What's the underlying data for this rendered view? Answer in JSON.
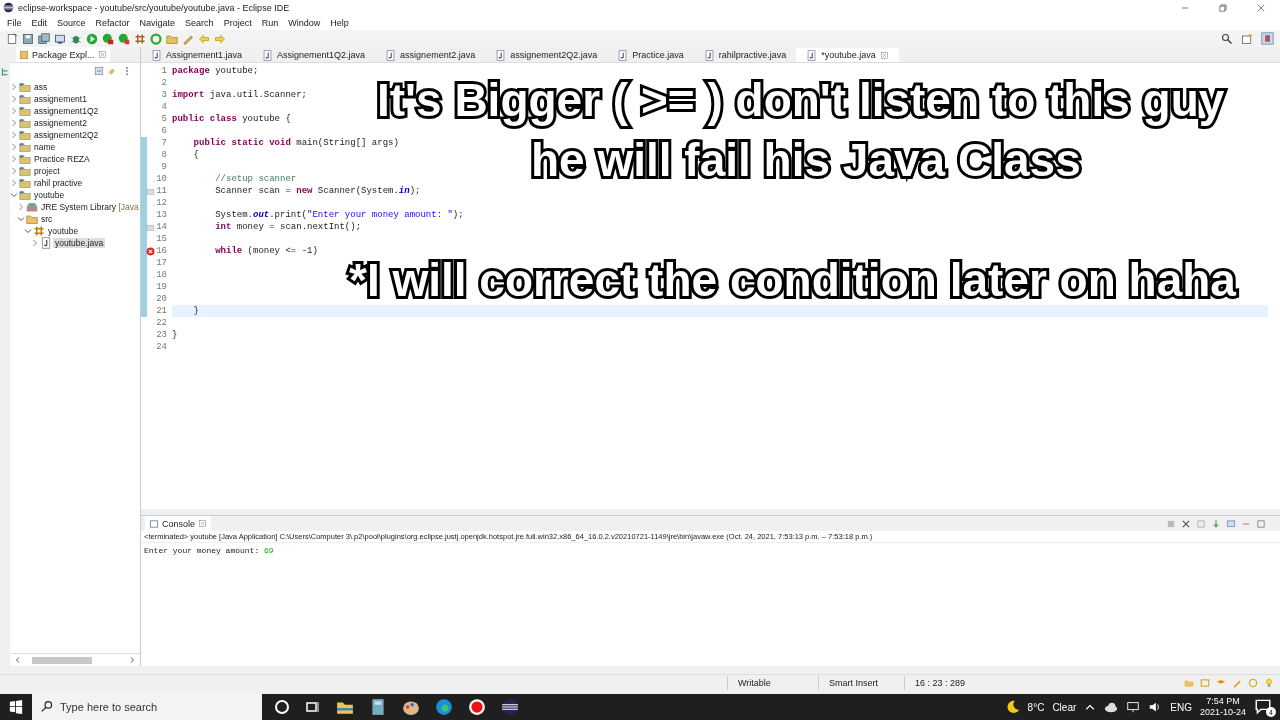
{
  "window": {
    "title": "eclipse-workspace - youtube/src/youtube/youtube.java - Eclipse IDE"
  },
  "menu": [
    "File",
    "Edit",
    "Source",
    "Refactor",
    "Navigate",
    "Search",
    "Project",
    "Run",
    "Window",
    "Help"
  ],
  "package_explorer": {
    "title": "Package Expl...",
    "tree": [
      {
        "label": "ass",
        "kind": "project",
        "expanded": false,
        "selected": false
      },
      {
        "label": "assignement1",
        "kind": "project",
        "expanded": false,
        "selected": false
      },
      {
        "label": "assignement1Q2",
        "kind": "project",
        "expanded": false,
        "selected": false
      },
      {
        "label": "assignement2",
        "kind": "project",
        "expanded": false,
        "selected": false
      },
      {
        "label": "assignement2Q2",
        "kind": "project",
        "expanded": false,
        "selected": false
      },
      {
        "label": "name",
        "kind": "project",
        "expanded": false,
        "selected": false
      },
      {
        "label": "Practice REZA",
        "kind": "project",
        "expanded": false,
        "selected": false
      },
      {
        "label": "project",
        "kind": "project",
        "expanded": false,
        "selected": false
      },
      {
        "label": "rahil practive",
        "kind": "project",
        "expanded": false,
        "selected": false
      },
      {
        "label": "youtube",
        "kind": "project",
        "expanded": true,
        "selected": false,
        "children": [
          {
            "label": "JRE System Library",
            "suffix": "[Java",
            "kind": "library",
            "expanded": false,
            "selected": false
          },
          {
            "label": "src",
            "kind": "folder",
            "expanded": true,
            "selected": false,
            "children": [
              {
                "label": "youtube",
                "kind": "package",
                "expanded": true,
                "selected": false,
                "children": [
                  {
                    "label": "youtube.java",
                    "kind": "file",
                    "expanded": false,
                    "selected": true
                  }
                ]
              }
            ]
          }
        ]
      }
    ]
  },
  "editor": {
    "tabs": [
      {
        "label": "Assignement1.java",
        "selected": false
      },
      {
        "label": "Assignement1Q2.java",
        "selected": false
      },
      {
        "label": "assignement2.java",
        "selected": false
      },
      {
        "label": "assignement2Q2.java",
        "selected": false
      },
      {
        "label": "Practice.java",
        "selected": false
      },
      {
        "label": "rahilpractive.java",
        "selected": false
      },
      {
        "label": "*youtube.java",
        "selected": true
      }
    ],
    "lines": [
      {
        "number": "1",
        "kind": "plain",
        "changed": false,
        "current": false,
        "tokens": [
          {
            "kind": "keyword",
            "text": "package"
          },
          {
            "kind": "plain",
            "text": " youtube;"
          }
        ]
      },
      {
        "number": "2",
        "kind": "plain",
        "changed": false,
        "current": false
      },
      {
        "number": "3",
        "kind": "plain",
        "changed": false,
        "current": false,
        "tokens": [
          {
            "kind": "keyword",
            "text": "import"
          },
          {
            "kind": "plain",
            "text": " java.util.Scanner;"
          }
        ]
      },
      {
        "number": "4",
        "kind": "plain",
        "changed": false,
        "current": false
      },
      {
        "number": "5",
        "kind": "plain",
        "changed": false,
        "current": false,
        "tokens": [
          {
            "kind": "keyword",
            "text": "public class"
          },
          {
            "kind": "plain",
            "text": " youtube {"
          }
        ]
      },
      {
        "number": "6",
        "kind": "plain",
        "changed": false,
        "current": false
      },
      {
        "number": "7",
        "kind": "plain",
        "changed": true,
        "current": false,
        "tokens": [
          {
            "kind": "keyword",
            "text": "    public static void"
          },
          {
            "kind": "plain",
            "text": " main(String[] args)"
          }
        ]
      },
      {
        "number": "8",
        "kind": "plain",
        "changed": true,
        "current": false,
        "tokens": [
          {
            "kind": "plain",
            "text": "    {"
          }
        ]
      },
      {
        "number": "9",
        "kind": "plain",
        "changed": true,
        "current": false
      },
      {
        "number": "10",
        "kind": "plain",
        "changed": true,
        "current": false,
        "tokens": [
          {
            "kind": "comment",
            "text": "        //setup scanner"
          }
        ]
      },
      {
        "number": "11",
        "kind": "note",
        "changed": true,
        "current": false,
        "tokens": [
          {
            "kind": "plain",
            "text": "        Scanner scan = "
          },
          {
            "kind": "keyword",
            "text": "new"
          },
          {
            "kind": "plain",
            "text": " Scanner(System."
          },
          {
            "kind": "field",
            "text": "in"
          },
          {
            "kind": "plain",
            "text": ");"
          }
        ]
      },
      {
        "number": "12",
        "kind": "plain",
        "changed": true,
        "current": false
      },
      {
        "number": "13",
        "kind": "plain",
        "changed": true,
        "current": false,
        "tokens": [
          {
            "kind": "plain",
            "text": "        System."
          },
          {
            "kind": "field",
            "text": "out"
          },
          {
            "kind": "plain",
            "text": ".print("
          },
          {
            "kind": "string",
            "text": "\"Enter your money amount: \""
          },
          {
            "kind": "plain",
            "text": ");"
          }
        ]
      },
      {
        "number": "14",
        "kind": "note",
        "changed": true,
        "current": false,
        "tokens": [
          {
            "kind": "keyword",
            "text": "        int"
          },
          {
            "kind": "plain",
            "text": " money = scan.nextInt();"
          }
        ]
      },
      {
        "number": "15",
        "kind": "plain",
        "changed": true,
        "current": false
      },
      {
        "number": "16",
        "kind": "error",
        "changed": true,
        "current": false,
        "tokens": [
          {
            "kind": "keyword",
            "text": "        while"
          },
          {
            "kind": "plain",
            "text": " (money <= -1)"
          }
        ]
      },
      {
        "number": "17",
        "kind": "plain",
        "changed": true,
        "current": false
      },
      {
        "number": "18",
        "kind": "plain",
        "changed": true,
        "current": false
      },
      {
        "number": "19",
        "kind": "plain",
        "changed": true,
        "current": false
      },
      {
        "number": "20",
        "kind": "plain",
        "changed": true,
        "current": false
      },
      {
        "number": "21",
        "kind": "plain",
        "changed": true,
        "current": true,
        "tokens": [
          {
            "kind": "plain",
            "text": "    }"
          }
        ]
      },
      {
        "number": "22",
        "kind": "plain",
        "changed": false,
        "current": false
      },
      {
        "number": "23",
        "kind": "plain",
        "changed": false,
        "current": false,
        "tokens": [
          {
            "kind": "plain",
            "text": "}"
          }
        ]
      },
      {
        "number": "24",
        "kind": "plain",
        "changed": false,
        "current": false
      }
    ]
  },
  "captions": [
    "It's Bigger ( >= ) don't listen to this guy",
    "he will fail his Java Class",
    "*I will correct the condition later on haha"
  ],
  "console": {
    "title": "Console",
    "header": "<terminated> youtube [Java Application] C:\\Users\\Computer 3\\.p2\\pool\\plugins\\org.eclipse.justj.openjdk.hotspot.jre.full.win32.x86_64_16.0.2.v20210721-1149\\jre\\bin\\javaw.exe  (Oct. 24, 2021, 7:53:13 p.m. – 7:53:18 p.m.)",
    "output": "Enter your money amount: ",
    "input": "69"
  },
  "status_bar": [
    "Writable",
    "Smart Insert",
    "16 : 23 : 289"
  ],
  "taskbar": {
    "search": {
      "placeholder": "Type here to search"
    },
    "temperature": "8°C",
    "weather": "Clear",
    "language": "ENG",
    "time": "7:54 PM",
    "date": "2021-10-24",
    "notifications": "4"
  }
}
